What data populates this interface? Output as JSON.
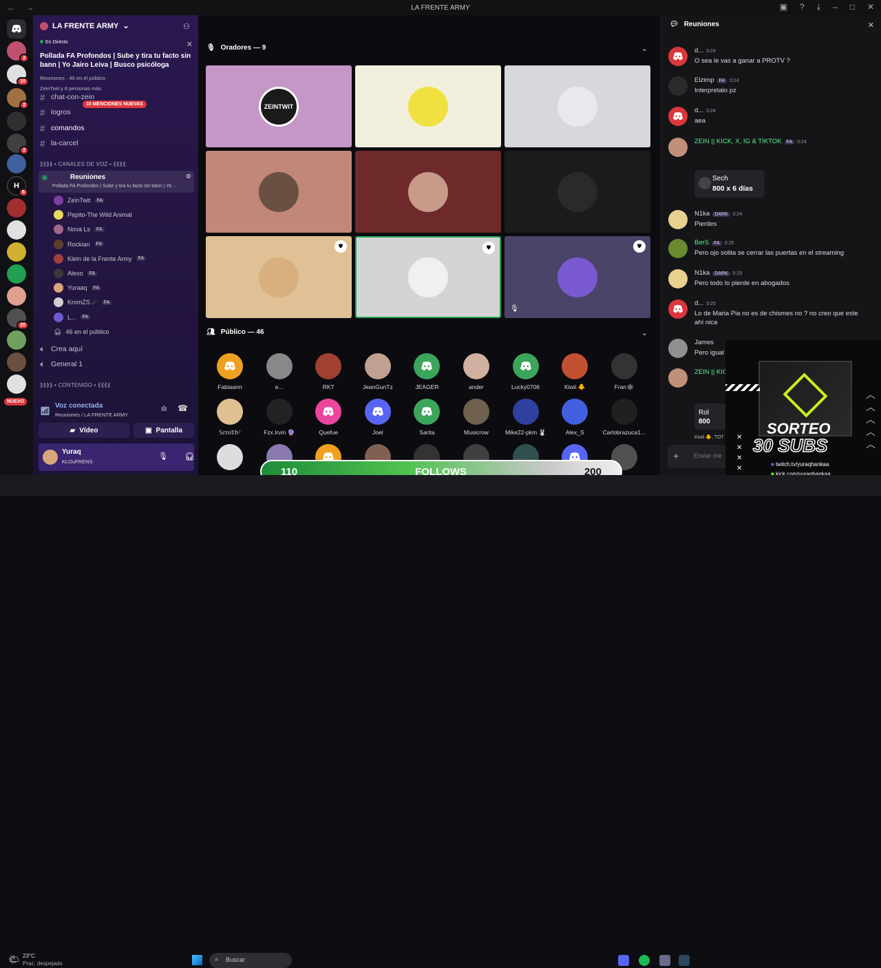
{
  "window": {
    "title": "LA FRENTE ARMY",
    "logo_icon": "discord-server-icon"
  },
  "servers": {
    "badges": [
      "2",
      "10",
      "2",
      "2",
      "6",
      "20"
    ],
    "nuevo_label": "NUEVO"
  },
  "sidebar": {
    "server_name": "LA FRENTE ARMY",
    "live_label": "En Directo",
    "stage_title": "Pollada FA Profondos | Sube y tira tu facto sin bann | Yo Jairo Leiva | Busco psicóloga",
    "stage_meta": "Reuniones · 46 en el público",
    "stage_people": "ZeinTwit y 8 personas más",
    "mentions_badge": "10 MENCIONES NUEVAS",
    "text_channels": [
      {
        "name": "chat-con-zein"
      },
      {
        "name": "logros"
      },
      {
        "name": "comandos"
      },
      {
        "name": "la-carcel"
      }
    ],
    "voice_category": "⟫⟫⟫⟫ • CANALES DE VOZ • ⟪⟪⟪⟪",
    "active_voice": {
      "name": "Reuniones",
      "sub": "Pollada FA Profondos | Sube y tira tu facto sin bann | Yo ...",
      "members": [
        {
          "name": "ZeinTwit",
          "tag": "FA",
          "color": "#7a3fa0"
        },
        {
          "name": "Pepito-The Wild Animal",
          "tag": "",
          "color": "#e8d95a"
        },
        {
          "name": "Nova Ls",
          "tag": "FA",
          "color": "#a06a8a"
        },
        {
          "name": "Rockian",
          "tag": "FA",
          "color": "#5a4030"
        },
        {
          "name": "Klein de la Frente Army",
          "tag": "FA",
          "color": "#a04040"
        },
        {
          "name": "Alexo",
          "tag": "FA",
          "color": "#3a3a3a"
        },
        {
          "name": "Yuraaq",
          "tag": "FA",
          "color": "#d9a57a"
        },
        {
          "name": "KromZS ☄",
          "tag": "FA",
          "color": "#cfcfcf"
        },
        {
          "name": "L...",
          "tag": "FA",
          "color": "#6a5acd"
        }
      ],
      "audience": "46 en el público"
    },
    "voice_channels": [
      {
        "name": "Crea aquí"
      },
      {
        "name": "General 1"
      }
    ],
    "content_category": "⟫⟫⟫⟫ • CONTENIDO • ⟪⟪⟪⟪",
    "voice_status": {
      "title": "Voz conectada",
      "sub": "Reuniones / LA FRENTE ARMY"
    },
    "video_label": "Vídeo",
    "screen_label": "Pantalla",
    "user": {
      "name": "Yuraq",
      "status": "KLOuFRENS"
    }
  },
  "stage": {
    "speakers_label": "Oradores — 9",
    "audience_label": "Público — 46",
    "speakers": [
      {
        "bg": "#c497c7",
        "av": "#1a1a1a",
        "text": "ZEINTWIT"
      },
      {
        "bg": "#f2f0dc",
        "av": "#f0e040",
        "text": ""
      },
      {
        "bg": "#d8d8dc",
        "av": "#e8e8ee",
        "text": ""
      },
      {
        "bg": "#c0877a",
        "av": "#6a5040",
        "text": ""
      },
      {
        "bg": "#6e2a2a",
        "av": "#c89a8a",
        "text": ""
      },
      {
        "bg": "#1a1c1c",
        "av": "#2a2a2a",
        "text": ""
      },
      {
        "bg": "#e0c094",
        "av": "#d8b080",
        "text": ""
      },
      {
        "bg": "#d4d4d4",
        "av": "#f0f0f0",
        "text": ""
      },
      {
        "bg": "#4a4468",
        "av": "#7a5ad0",
        "text": ""
      }
    ],
    "audience": [
      {
        "name": "Fabiaann",
        "color": "#f0a020",
        "icon": "discord"
      },
      {
        "name": "e...",
        "color": "#888888",
        "icon": ""
      },
      {
        "name": "RKT",
        "color": "#a04030",
        "icon": ""
      },
      {
        "name": "JeanGunTz",
        "color": "#c0a090",
        "icon": ""
      },
      {
        "name": "JEAGER",
        "color": "#3ba55c",
        "icon": "discord"
      },
      {
        "name": "ander",
        "color": "#d0b0a0",
        "icon": ""
      },
      {
        "name": "Lucky0706",
        "color": "#3ba55c",
        "icon": "discord"
      },
      {
        "name": "Kiwii 🐥",
        "color": "#c05030",
        "icon": ""
      },
      {
        "name": "Fran🕸",
        "color": "#333333",
        "icon": ""
      },
      {
        "name": "𝕊𝕞𝕚𝕥𝕙⁷",
        "color": "#e0c090",
        "icon": ""
      },
      {
        "name": "Fzx.Irvin 🔮",
        "color": "#222222",
        "icon": ""
      },
      {
        "name": "Quefue",
        "color": "#eb459e",
        "icon": "discord"
      },
      {
        "name": "Joel",
        "color": "#5865f2",
        "icon": "discord"
      },
      {
        "name": "Sarita",
        "color": "#3ba55c",
        "icon": "discord"
      },
      {
        "name": "Musicrow",
        "color": "#706050",
        "icon": ""
      },
      {
        "name": "Mike22-pkm 🐰",
        "color": "#3040a0",
        "icon": ""
      },
      {
        "name": "Alex_S",
        "color": "#4060e0",
        "icon": ""
      },
      {
        "name": "Carlobrazuca1...",
        "color": "#202020",
        "icon": ""
      },
      {
        "name": "",
        "color": "#dddddd",
        "icon": ""
      },
      {
        "name": "",
        "color": "#8a7ab0",
        "icon": ""
      },
      {
        "name": "",
        "color": "#f0a020",
        "icon": "discord"
      },
      {
        "name": "",
        "color": "#806050",
        "icon": ""
      },
      {
        "name": "",
        "color": "#333333",
        "icon": ""
      },
      {
        "name": "",
        "color": "#404040",
        "icon": ""
      },
      {
        "name": "",
        "color": "#305050",
        "icon": ""
      },
      {
        "name": "",
        "color": "#5865f2",
        "icon": "discord"
      },
      {
        "name": "",
        "color": "#505050",
        "icon": ""
      }
    ]
  },
  "chat": {
    "title": "Reuniones",
    "messages": [
      {
        "name": "d...",
        "time": "0:24",
        "text": "O sea le vas a ganar a PROTV ?",
        "color": "#da373c",
        "nameColor": "#dbdee1"
      },
      {
        "name": "Elzimp",
        "time": "0:24",
        "text": "Interpretalo pz",
        "color": "#2a2a2a",
        "nameColor": "#dbdee1"
      },
      {
        "name": "d...",
        "time": "0:24",
        "text": "aea",
        "color": "#da373c",
        "nameColor": "#dbdee1"
      },
      {
        "name": "ZEIN || KICK, X, IG & TIKTOK",
        "time": "0:24",
        "text": "",
        "color": "#c0907a",
        "nameColor": "#57f287"
      },
      {
        "name": "N1ka",
        "time": "0:24",
        "text": "Pierdes",
        "color": "#e8d090",
        "nameColor": "#dbdee1"
      },
      {
        "name": "BerS",
        "time": "0:25",
        "text": "Pero ojo solita se cerrar las puertas en el streaming",
        "color": "#6a8a30",
        "nameColor": "#57f287"
      },
      {
        "name": "N1ka",
        "time": "0:25",
        "text": "Pero todo lo pierde en abogados",
        "color": "#e8d090",
        "nameColor": "#dbdee1"
      },
      {
        "name": "d...",
        "time": "0:25",
        "text": "Lo de Maria Pia no es de chismes no ? no creo que este ahí nica",
        "color": "#da373c",
        "nameColor": "#dbdee1"
      },
      {
        "name": "James",
        "time": "",
        "text": "Pero igual",
        "color": "#909090",
        "nameColor": "#dbdee1"
      },
      {
        "name": "ZEIN || KIC",
        "time": "",
        "text": "",
        "color": "#c0907a",
        "nameColor": "#57f287"
      }
    ],
    "tag_fa": "FA",
    "tag_dark": "DARK",
    "sech_name": "Sech",
    "sech_text": "800 x 6 días",
    "rol_name": "Rol",
    "rol_text": "800",
    "typing": "Kiwii 🐥, TOT",
    "input_placeholder": "Enviar me"
  },
  "promo": {
    "line1": "SORTEO",
    "line2": "30 SUBS",
    "twitch": "twitch.tv/yuraqhankaa",
    "kick": "kick.com/yuraqhankaa"
  },
  "follows": {
    "left": "110",
    "label": "FOLLOWS",
    "right": "200"
  },
  "taskbar": {
    "temp": "23°C",
    "weather": "Prac. despejado",
    "search": "Buscar"
  }
}
